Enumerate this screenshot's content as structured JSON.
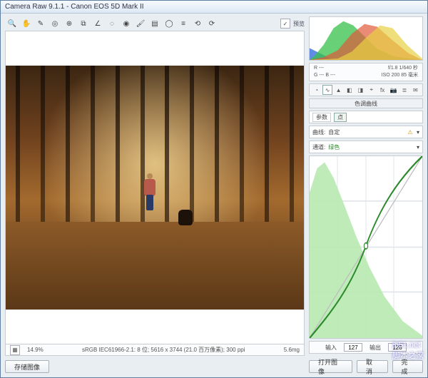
{
  "window": {
    "title": "Camera Raw 9.1.1  -  Canon EOS 5D Mark II"
  },
  "toolbar": {
    "tools": [
      {
        "name": "zoom-icon",
        "glyph": "🔍"
      },
      {
        "name": "hand-icon",
        "glyph": "✋"
      },
      {
        "name": "white-balance-icon",
        "glyph": "✎"
      },
      {
        "name": "color-sampler-icon",
        "glyph": "◎"
      },
      {
        "name": "target-adjust-icon",
        "glyph": "⊕"
      },
      {
        "name": "crop-icon",
        "glyph": "⧉"
      },
      {
        "name": "straighten-icon",
        "glyph": "∠"
      },
      {
        "name": "spot-removal-icon",
        "glyph": "◌"
      },
      {
        "name": "redeye-icon",
        "glyph": "◉"
      },
      {
        "name": "adjust-brush-icon",
        "glyph": "🖌"
      },
      {
        "name": "graduated-filter-icon",
        "glyph": "▤"
      },
      {
        "name": "radial-filter-icon",
        "glyph": "◯"
      },
      {
        "name": "prefs-icon",
        "glyph": "≡"
      },
      {
        "name": "rotate-ccw-icon",
        "glyph": "⟲"
      },
      {
        "name": "rotate-cw-icon",
        "glyph": "⟳"
      }
    ]
  },
  "preview": {
    "toggle_label": "预览"
  },
  "status": {
    "zoom": "14.9%",
    "file_info": "sRGB IEC61966-2.1: 8 位; 5616 x 3744 (21.0 百万像素); 300 ppi",
    "f_stop": "5.6mg"
  },
  "left_buttons": {
    "save_image": "存储图像"
  },
  "meta": {
    "r": "---",
    "g": "---",
    "b": "---",
    "aperture": "f/1.8",
    "shutter": "1/640 秒",
    "iso": "ISO 200",
    "lens": "85 毫米"
  },
  "icon_tabs": [
    {
      "name": "basic-icon",
      "glyph": "◔"
    },
    {
      "name": "curve-tab-icon",
      "glyph": "∿",
      "active": true
    },
    {
      "name": "detail-icon",
      "glyph": "▲"
    },
    {
      "name": "hsl-icon",
      "glyph": "◧"
    },
    {
      "name": "split-icon",
      "glyph": "◨"
    },
    {
      "name": "lens-icon",
      "glyph": "⌖"
    },
    {
      "name": "fx-icon",
      "glyph": "fx"
    },
    {
      "name": "camera-icon",
      "glyph": "📷"
    },
    {
      "name": "presets-icon",
      "glyph": "≣"
    },
    {
      "name": "snapshots-icon",
      "glyph": "✉"
    }
  ],
  "panel": {
    "title": "色调曲线",
    "mode_tabs": {
      "parametric": "参数",
      "point": "点"
    },
    "curve_label": "曲线:",
    "curve_value": "自定",
    "channel_label": "通道:",
    "channel_value": "绿色",
    "input_label": "输入",
    "input_value": "127",
    "output_label": "输出",
    "output_value": "128"
  },
  "right_buttons": {
    "open_image": "打开图像",
    "cancel": "取消",
    "done": "完成"
  },
  "watermark": {
    "line1": "jb51.net",
    "line2": "脚本之家"
  },
  "chart_data": [
    {
      "type": "area",
      "title": "RGB Histogram",
      "xlim": [
        0,
        255
      ],
      "ylim": [
        0,
        100
      ],
      "series": [
        {
          "name": "blue",
          "color": "#3a6fe0",
          "values": [
            5,
            4,
            3,
            2,
            1,
            0,
            0,
            0,
            0,
            0,
            0,
            0,
            0,
            0,
            0,
            0
          ]
        },
        {
          "name": "green",
          "color": "#35c24a",
          "values": [
            2,
            4,
            10,
            30,
            55,
            70,
            50,
            35,
            20,
            10,
            5,
            2,
            1,
            0,
            0,
            0
          ]
        },
        {
          "name": "red",
          "color": "#e05a3a",
          "values": [
            0,
            1,
            3,
            8,
            18,
            35,
            55,
            65,
            55,
            40,
            25,
            12,
            6,
            3,
            1,
            0
          ]
        },
        {
          "name": "yellow",
          "color": "#e8d245",
          "values": [
            0,
            0,
            0,
            2,
            6,
            14,
            28,
            46,
            62,
            58,
            40,
            22,
            10,
            4,
            1,
            0
          ]
        }
      ]
    },
    {
      "type": "line",
      "title": "Tone Curve (Green channel)",
      "xlabel": "输入",
      "ylabel": "输出",
      "xlim": [
        0,
        255
      ],
      "ylim": [
        0,
        255
      ],
      "series": [
        {
          "name": "diagonal",
          "values": [
            [
              0,
              0
            ],
            [
              255,
              255
            ]
          ]
        },
        {
          "name": "curve",
          "values": [
            [
              0,
              0
            ],
            [
              40,
              32
            ],
            [
              80,
              70
            ],
            [
              127,
              128
            ],
            [
              170,
              180
            ],
            [
              210,
              222
            ],
            [
              255,
              255
            ]
          ]
        }
      ],
      "histogram_backdrop": {
        "color": "#b8e9b1",
        "values": [
          80,
          95,
          100,
          88,
          70,
          55,
          42,
          32,
          24,
          18,
          13,
          9,
          6,
          4,
          2,
          1
        ]
      }
    }
  ]
}
